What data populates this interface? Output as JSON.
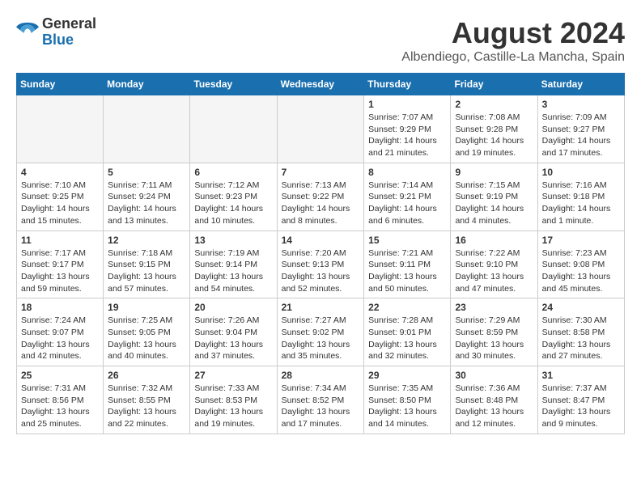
{
  "header": {
    "logo_general": "General",
    "logo_blue": "Blue",
    "month_year": "August 2024",
    "location": "Albendiego, Castille-La Mancha, Spain"
  },
  "days_of_week": [
    "Sunday",
    "Monday",
    "Tuesday",
    "Wednesday",
    "Thursday",
    "Friday",
    "Saturday"
  ],
  "weeks": [
    [
      {
        "day": "",
        "empty": true
      },
      {
        "day": "",
        "empty": true
      },
      {
        "day": "",
        "empty": true
      },
      {
        "day": "",
        "empty": true
      },
      {
        "day": "1",
        "sunrise": "7:07 AM",
        "sunset": "9:29 PM",
        "daylight": "14 hours and 21 minutes."
      },
      {
        "day": "2",
        "sunrise": "7:08 AM",
        "sunset": "9:28 PM",
        "daylight": "14 hours and 19 minutes."
      },
      {
        "day": "3",
        "sunrise": "7:09 AM",
        "sunset": "9:27 PM",
        "daylight": "14 hours and 17 minutes."
      }
    ],
    [
      {
        "day": "4",
        "sunrise": "7:10 AM",
        "sunset": "9:25 PM",
        "daylight": "14 hours and 15 minutes."
      },
      {
        "day": "5",
        "sunrise": "7:11 AM",
        "sunset": "9:24 PM",
        "daylight": "14 hours and 13 minutes."
      },
      {
        "day": "6",
        "sunrise": "7:12 AM",
        "sunset": "9:23 PM",
        "daylight": "14 hours and 10 minutes."
      },
      {
        "day": "7",
        "sunrise": "7:13 AM",
        "sunset": "9:22 PM",
        "daylight": "14 hours and 8 minutes."
      },
      {
        "day": "8",
        "sunrise": "7:14 AM",
        "sunset": "9:21 PM",
        "daylight": "14 hours and 6 minutes."
      },
      {
        "day": "9",
        "sunrise": "7:15 AM",
        "sunset": "9:19 PM",
        "daylight": "14 hours and 4 minutes."
      },
      {
        "day": "10",
        "sunrise": "7:16 AM",
        "sunset": "9:18 PM",
        "daylight": "14 hours and 1 minute."
      }
    ],
    [
      {
        "day": "11",
        "sunrise": "7:17 AM",
        "sunset": "9:17 PM",
        "daylight": "13 hours and 59 minutes."
      },
      {
        "day": "12",
        "sunrise": "7:18 AM",
        "sunset": "9:15 PM",
        "daylight": "13 hours and 57 minutes."
      },
      {
        "day": "13",
        "sunrise": "7:19 AM",
        "sunset": "9:14 PM",
        "daylight": "13 hours and 54 minutes."
      },
      {
        "day": "14",
        "sunrise": "7:20 AM",
        "sunset": "9:13 PM",
        "daylight": "13 hours and 52 minutes."
      },
      {
        "day": "15",
        "sunrise": "7:21 AM",
        "sunset": "9:11 PM",
        "daylight": "13 hours and 50 minutes."
      },
      {
        "day": "16",
        "sunrise": "7:22 AM",
        "sunset": "9:10 PM",
        "daylight": "13 hours and 47 minutes."
      },
      {
        "day": "17",
        "sunrise": "7:23 AM",
        "sunset": "9:08 PM",
        "daylight": "13 hours and 45 minutes."
      }
    ],
    [
      {
        "day": "18",
        "sunrise": "7:24 AM",
        "sunset": "9:07 PM",
        "daylight": "13 hours and 42 minutes."
      },
      {
        "day": "19",
        "sunrise": "7:25 AM",
        "sunset": "9:05 PM",
        "daylight": "13 hours and 40 minutes."
      },
      {
        "day": "20",
        "sunrise": "7:26 AM",
        "sunset": "9:04 PM",
        "daylight": "13 hours and 37 minutes."
      },
      {
        "day": "21",
        "sunrise": "7:27 AM",
        "sunset": "9:02 PM",
        "daylight": "13 hours and 35 minutes."
      },
      {
        "day": "22",
        "sunrise": "7:28 AM",
        "sunset": "9:01 PM",
        "daylight": "13 hours and 32 minutes."
      },
      {
        "day": "23",
        "sunrise": "7:29 AM",
        "sunset": "8:59 PM",
        "daylight": "13 hours and 30 minutes."
      },
      {
        "day": "24",
        "sunrise": "7:30 AM",
        "sunset": "8:58 PM",
        "daylight": "13 hours and 27 minutes."
      }
    ],
    [
      {
        "day": "25",
        "sunrise": "7:31 AM",
        "sunset": "8:56 PM",
        "daylight": "13 hours and 25 minutes."
      },
      {
        "day": "26",
        "sunrise": "7:32 AM",
        "sunset": "8:55 PM",
        "daylight": "13 hours and 22 minutes."
      },
      {
        "day": "27",
        "sunrise": "7:33 AM",
        "sunset": "8:53 PM",
        "daylight": "13 hours and 19 minutes."
      },
      {
        "day": "28",
        "sunrise": "7:34 AM",
        "sunset": "8:52 PM",
        "daylight": "13 hours and 17 minutes."
      },
      {
        "day": "29",
        "sunrise": "7:35 AM",
        "sunset": "8:50 PM",
        "daylight": "13 hours and 14 minutes."
      },
      {
        "day": "30",
        "sunrise": "7:36 AM",
        "sunset": "8:48 PM",
        "daylight": "13 hours and 12 minutes."
      },
      {
        "day": "31",
        "sunrise": "7:37 AM",
        "sunset": "8:47 PM",
        "daylight": "13 hours and 9 minutes."
      }
    ]
  ],
  "labels": {
    "sunrise": "Sunrise:",
    "sunset": "Sunset:",
    "daylight": "Daylight:"
  }
}
